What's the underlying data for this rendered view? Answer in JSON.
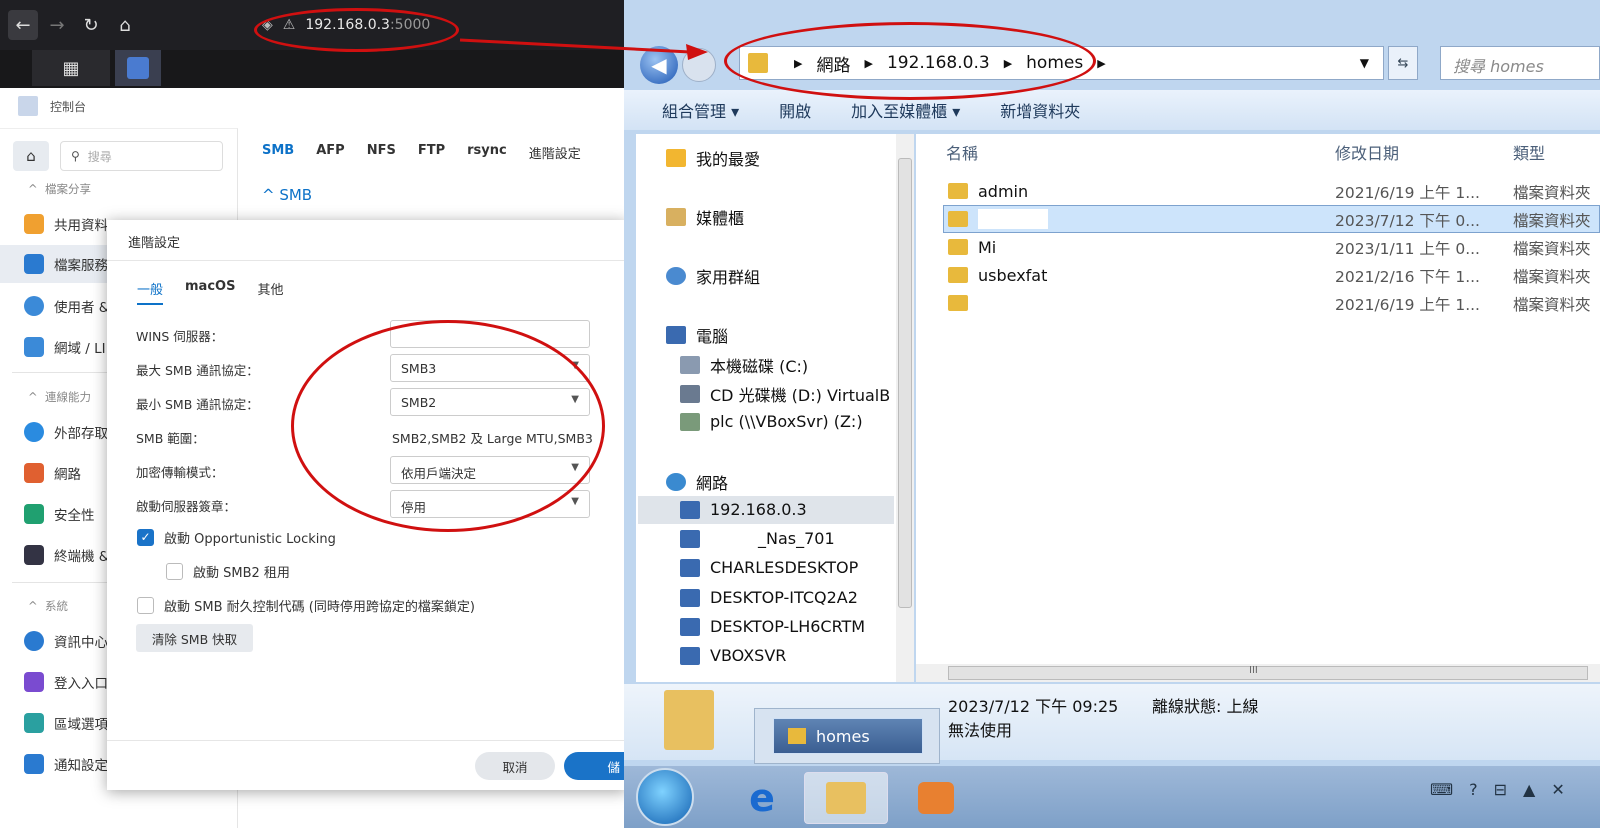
{
  "browser": {
    "url_host": "192.168.0.3",
    "url_port": ":5000",
    "back_icon": "←",
    "forward_icon": "→",
    "reload_icon": "↻",
    "home_icon": "⌂",
    "apps_icon": "▦"
  },
  "dsm": {
    "app_title": "控制台",
    "search_placeholder": "搜尋",
    "sidebar": {
      "sections": [
        "檔案分享",
        "連線能力",
        "系統"
      ],
      "items": [
        {
          "label": "共用資料",
          "color": "#f0a030"
        },
        {
          "label": "檔案服務",
          "color": "#2a7ad0"
        },
        {
          "label": "使用者 &",
          "color": "#3b8ad8"
        },
        {
          "label": "網域 / LI",
          "color": "#3b8ad8"
        },
        {
          "label": "外部存取",
          "color": "#2a8be0"
        },
        {
          "label": "網路",
          "color": "#e06030"
        },
        {
          "label": "安全性",
          "color": "#20a070"
        },
        {
          "label": "終端機 &",
          "color": "#334"
        },
        {
          "label": "資訊中心",
          "color": "#2a7ad0"
        },
        {
          "label": "登入入口",
          "color": "#7a4bd0"
        },
        {
          "label": "區域選項",
          "color": "#2aa0a0"
        },
        {
          "label": "通知設定",
          "color": "#2a7ad0"
        }
      ]
    },
    "tabs": [
      "SMB",
      "AFP",
      "NFS",
      "FTP",
      "rsync",
      "進階設定"
    ],
    "section_header": "SMB"
  },
  "dialog": {
    "title": "進階設定",
    "tabs": [
      "一般",
      "macOS",
      "其他"
    ],
    "fields": {
      "wins_label": "WINS 伺服器：",
      "wins_value": "",
      "max_label": "最大 SMB 通訊協定：",
      "max_value": "SMB3",
      "min_label": "最小 SMB 通訊協定：",
      "min_value": "SMB2",
      "range_label": "SMB 範圍：",
      "range_value": "SMB2,SMB2 及 Large MTU,SMB3",
      "enc_label": "加密傳輸模式：",
      "enc_value": "依用戶端決定",
      "sign_label": "啟動伺服器簽章：",
      "sign_value": "停用"
    },
    "checks": {
      "oplock": "啟動 Opportunistic Locking",
      "lease": "啟動 SMB2 租用",
      "durable": "啟動 SMB 耐久控制代碼 (同時停用跨協定的檔案鎖定)"
    },
    "clear_btn": "清除 SMB 快取",
    "cancel_btn": "取消",
    "ok_btn": "儲"
  },
  "explorer": {
    "breadcrumb": [
      "網路",
      "192.168.0.3",
      "homes"
    ],
    "search_placeholder": "搜尋 homes",
    "commands": [
      "組合管理 ▾",
      "開啟",
      "加入至媒體櫃 ▾",
      "新增資料夾"
    ],
    "nav": {
      "favorites": "我的最愛",
      "libraries": "媒體櫃",
      "homegroup": "家用群組",
      "computer": "電腦",
      "drive_c": "本機磁碟 (C:)",
      "drive_d": "CD 光碟機 (D:) VirtualB",
      "drive_z": "plc (\\\\VBoxSvr) (Z:)",
      "network": "網路",
      "hosts": [
        "192.168.0.3",
        "_Nas_701",
        "CHARLESDESKTOP",
        "DESKTOP-ITCQ2A2",
        "DESKTOP-LH6CRTM",
        "VBOXSVR"
      ]
    },
    "columns": [
      "名稱",
      "修改日期",
      "類型"
    ],
    "files": [
      {
        "name": "admin",
        "date": "2021/6/19 上午 1...",
        "type": "檔案資料夾"
      },
      {
        "name": "",
        "date": "2023/7/12 下午 0...",
        "type": "檔案資料夾"
      },
      {
        "name": "Mi",
        "date": "2023/1/11 上午 0...",
        "type": "檔案資料夾"
      },
      {
        "name": "usbexfat",
        "date": "2021/2/16 下午 1...",
        "type": "檔案資料夾"
      },
      {
        "name": "",
        "date": "2021/6/19 上午 1...",
        "type": "檔案資料夾"
      }
    ],
    "details": {
      "modified": "2023/7/12 下午 09:25",
      "offline_status": "離線狀態: 上線",
      "availability": "無法使用"
    },
    "tooltip": "homes",
    "scroll_mid": "III"
  }
}
